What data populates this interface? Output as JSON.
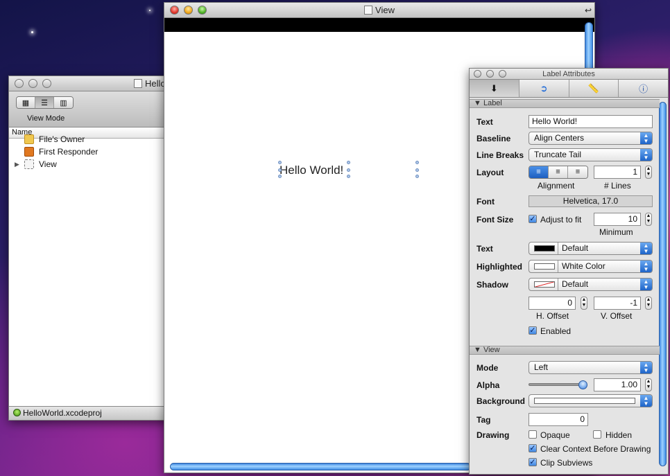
{
  "doc_window": {
    "title": "Hello",
    "view_mode_label": "View Mode",
    "column_header": "Name",
    "items": [
      {
        "label": "File's Owner",
        "icon": "cube-icon",
        "color": "#f0c850"
      },
      {
        "label": "First Responder",
        "icon": "cube-icon",
        "color": "#e07820"
      },
      {
        "label": "View",
        "icon": "view-icon",
        "color": "#f2f2f2"
      }
    ],
    "status": "HelloWorld.xcodeproj"
  },
  "view_window": {
    "title": "View",
    "label_text": "Hello World!"
  },
  "inspector": {
    "title": "Label Attributes",
    "tabs": [
      "attributes",
      "connections",
      "size",
      "identity"
    ],
    "label_section": "Label",
    "text_label": "Text",
    "text_value": "Hello World!",
    "baseline_label": "Baseline",
    "baseline_value": "Align Centers",
    "linebreaks_label": "Line Breaks",
    "linebreaks_value": "Truncate Tail",
    "layout_label": "Layout",
    "alignment_caption": "Alignment",
    "lines_value": "1",
    "lines_caption": "# Lines",
    "font_label": "Font",
    "font_value": "Helvetica, 17.0",
    "fontsize_label": "Font Size",
    "adjust_label": "Adjust to fit",
    "min_value": "10",
    "min_caption": "Minimum",
    "textcolor_label": "Text",
    "textcolor_value": "Default",
    "highlighted_label": "Highlighted",
    "highlighted_value": "White Color",
    "shadow_label": "Shadow",
    "shadow_value": "Default",
    "hoffset_value": "0",
    "hoffset_caption": "H. Offset",
    "voffset_value": "-1",
    "voffset_caption": "V. Offset",
    "enabled_label": "Enabled",
    "view_section": "View",
    "mode_label": "Mode",
    "mode_value": "Left",
    "alpha_label": "Alpha",
    "alpha_value": "1.00",
    "background_label": "Background",
    "tag_label": "Tag",
    "tag_value": "0",
    "drawing_label": "Drawing",
    "opaque_label": "Opaque",
    "hidden_label": "Hidden",
    "clear_label": "Clear Context Before Drawing",
    "clip_label": "Clip Subviews"
  }
}
